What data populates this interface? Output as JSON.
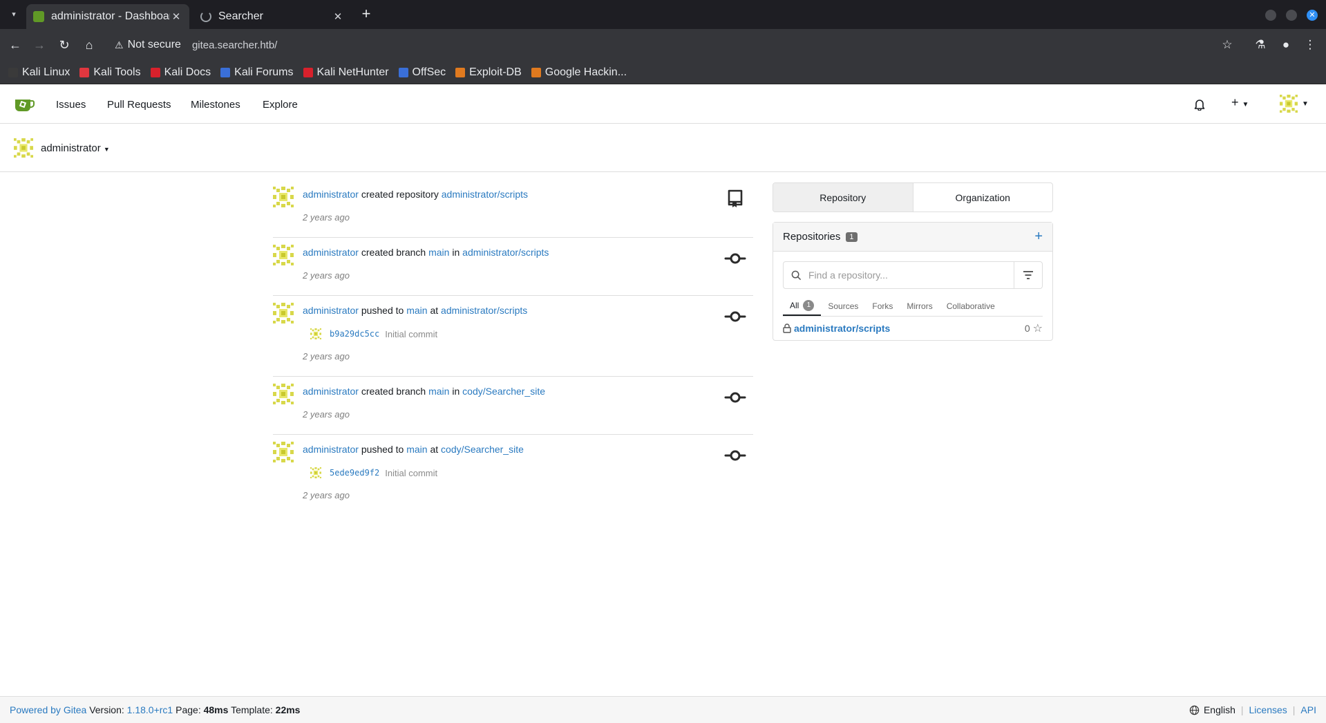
{
  "browser": {
    "tabs": [
      {
        "title": "administrator - Dashboard",
        "active": true,
        "favicon": "gitea-icon"
      },
      {
        "title": "Searcher",
        "active": false,
        "favicon": "loading-spinner-icon"
      }
    ],
    "security_label": "Not secure",
    "url": "gitea.searcher.htb/",
    "bookmarks": [
      {
        "label": "Kali Linux",
        "color": "#3a3a3a"
      },
      {
        "label": "Kali Tools",
        "color": "#e0373f"
      },
      {
        "label": "Kali Docs",
        "color": "#d8212c"
      },
      {
        "label": "Kali Forums",
        "color": "#3a6fd8"
      },
      {
        "label": "Kali NetHunter",
        "color": "#d8212c"
      },
      {
        "label": "OffSec",
        "color": "#3a6fd8"
      },
      {
        "label": "Exploit-DB",
        "color": "#e07a1f"
      },
      {
        "label": "Google Hackin...",
        "color": "#e07a1f"
      }
    ]
  },
  "nav": {
    "links": [
      "Issues",
      "Pull Requests",
      "Milestones",
      "Explore"
    ]
  },
  "context": {
    "user": "administrator"
  },
  "feed": [
    {
      "actor": "administrator",
      "action": "created repository",
      "target": "administrator/scripts",
      "time": "2 years ago",
      "icon": "repo-icon"
    },
    {
      "actor": "administrator",
      "action": "created branch",
      "branch": "main",
      "connector": "in",
      "target": "administrator/scripts",
      "time": "2 years ago",
      "icon": "commit-icon"
    },
    {
      "actor": "administrator",
      "action": "pushed to",
      "branch": "main",
      "connector": "at",
      "target": "administrator/scripts",
      "commit_sha": "b9a29dc5cc",
      "commit_msg": "Initial commit",
      "time": "2 years ago",
      "icon": "commit-icon"
    },
    {
      "actor": "administrator",
      "action": "created branch",
      "branch": "main",
      "connector": "in",
      "target": "cody/Searcher_site",
      "time": "2 years ago",
      "icon": "commit-icon"
    },
    {
      "actor": "administrator",
      "action": "pushed to",
      "branch": "main",
      "connector": "at",
      "target": "cody/Searcher_site",
      "commit_sha": "5ede9ed9f2",
      "commit_msg": "Initial commit",
      "time": "2 years ago",
      "icon": "commit-icon"
    }
  ],
  "sidebar": {
    "segments": [
      "Repository",
      "Organization"
    ],
    "repos_title": "Repositories",
    "repos_count": "1",
    "search_placeholder": "Find a repository...",
    "filter_tabs": [
      {
        "label": "All",
        "count": "1"
      },
      {
        "label": "Sources"
      },
      {
        "label": "Forks"
      },
      {
        "label": "Mirrors"
      },
      {
        "label": "Collaborative"
      }
    ],
    "repos": [
      {
        "name": "administrator/scripts",
        "stars": "0"
      }
    ]
  },
  "footer": {
    "powered": "Powered by Gitea",
    "version_label": "Version:",
    "version": "1.18.0+rc1",
    "page_label": "Page:",
    "page_time": "48ms",
    "template_label": "Template:",
    "template_time": "22ms",
    "language": "English",
    "licenses": "Licenses",
    "api": "API"
  },
  "colors": {
    "link": "#2a7ac0",
    "gitea_green": "#609926",
    "avatar_yellow": "#d8d84a"
  }
}
